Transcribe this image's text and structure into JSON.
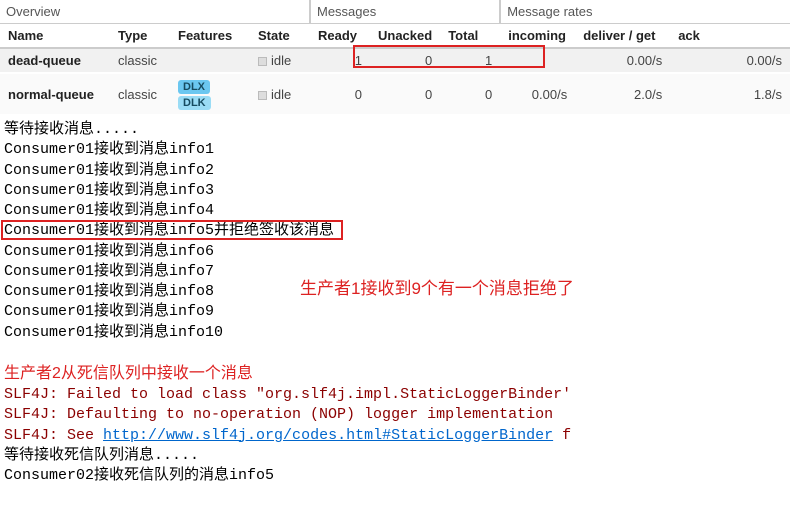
{
  "table": {
    "sections": {
      "overview": "Overview",
      "messages": "Messages",
      "rates": "Message rates"
    },
    "headers": {
      "name": "Name",
      "type": "Type",
      "features": "Features",
      "state": "State",
      "ready": "Ready",
      "unacked": "Unacked",
      "total": "Total",
      "incoming": "incoming",
      "deliverget": "deliver / get",
      "ack": "ack"
    },
    "rows": [
      {
        "name": "dead-queue",
        "type": "classic",
        "features": [],
        "state": "idle",
        "ready": "1",
        "unacked": "0",
        "total": "1",
        "incoming": "",
        "deliverget": "0.00/s",
        "ack": "0.00/s"
      },
      {
        "name": "normal-queue",
        "type": "classic",
        "features": [
          "DLX",
          "DLK"
        ],
        "state": "idle",
        "ready": "0",
        "unacked": "0",
        "total": "0",
        "incoming": "0.00/s",
        "deliverget": "2.0/s",
        "ack": "1.8/s"
      }
    ]
  },
  "console1": {
    "wait": "等待接收消息.....",
    "l1": "Consumer01接收到消息info1",
    "l2": "Consumer01接收到消息info2",
    "l3": "Consumer01接收到消息info3",
    "l4": "Consumer01接收到消息info4",
    "l5": "Consumer01接收到消息info5并拒绝签收该消息",
    "l6": "Consumer01接收到消息info6",
    "l7": "Consumer01接收到消息info7",
    "l8": "Consumer01接收到消息info8",
    "l9": "Consumer01接收到消息info9",
    "l10": "Consumer01接收到消息info10"
  },
  "annotation1": "生产者1接收到9个有一个消息拒绝了",
  "console2": {
    "title": "生产者2从死信队列中接收一个消息",
    "slf1a": "SLF4J: Failed to load class \"org.slf4j.impl.StaticLoggerBinder'",
    "slf2": "SLF4J: Defaulting to no-operation (NOP) logger implementation",
    "slf3a": "SLF4J: See ",
    "slf3link": "http://www.slf4j.org/codes.html#StaticLoggerBinder",
    "slf3b": " f",
    "wait2": "等待接收死信队列消息.....",
    "recv": "Consumer02接收死信队列的消息info5"
  }
}
